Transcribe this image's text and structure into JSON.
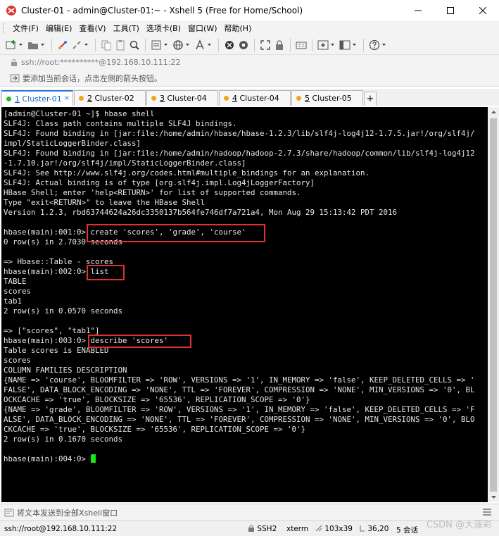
{
  "window": {
    "title": "Cluster-01 - admin@Cluster-01:~ - Xshell 5 (Free for Home/School)"
  },
  "menu": [
    "文件(F)",
    "编辑(E)",
    "查看(V)",
    "工具(T)",
    "选项卡(B)",
    "窗口(W)",
    "帮助(H)"
  ],
  "address": {
    "text": "ssh://root:**********@192.168.10.111:22"
  },
  "info": {
    "text": "要添加当前会话，点击左侧的箭头按钮。"
  },
  "tabs": [
    {
      "num": "1",
      "label": "Cluster-01",
      "color": "#2fb52f",
      "active": true,
      "close": "×"
    },
    {
      "num": "2",
      "label": "Cluster-02",
      "color": "#f2a51a"
    },
    {
      "num": "3",
      "label": "Cluster-04",
      "color": "#f2a51a"
    },
    {
      "num": "4",
      "label": "Cluster-04",
      "color": "#f2a51a"
    },
    {
      "num": "5",
      "label": "Cluster-05",
      "color": "#f2a51a"
    }
  ],
  "tab_add": "+",
  "terminal": {
    "lines": [
      "[admin@Cluster-01 ~]$ hbase shell",
      "SLF4J: Class path contains multiple SLF4J bindings.",
      "SLF4J: Found binding in [jar:file:/home/admin/hbase/hbase-1.2.3/lib/slf4j-log4j12-1.7.5.jar!/org/slf4j/",
      "impl/StaticLoggerBinder.class]",
      "SLF4J: Found binding in [jar:file:/home/admin/hadoop/hadoop-2.7.3/share/hadoop/common/lib/slf4j-log4j12",
      "-1.7.10.jar!/org/slf4j/impl/StaticLoggerBinder.class]",
      "SLF4J: See http://www.slf4j.org/codes.html#multiple_bindings for an explanation.",
      "SLF4J: Actual binding is of type [org.slf4j.impl.Log4jLoggerFactory]",
      "HBase Shell; enter 'help<RETURN>' for list of supported commands.",
      "Type \"exit<RETURN>\" to leave the HBase Shell",
      "Version 1.2.3, rbd63744624a26dc3350137b564fe746df7a721a4, Mon Aug 29 15:13:42 PDT 2016",
      "",
      "hbase(main):001:0> create 'scores', 'grade', 'course'",
      "0 row(s) in 2.7030 seconds",
      "",
      "=> Hbase::Table - scores",
      "hbase(main):002:0> list",
      "TABLE",
      "scores",
      "tab1",
      "2 row(s) in 0.0570 seconds",
      "",
      "=> [\"scores\", \"tab1\"]",
      "hbase(main):003:0> describe 'scores'",
      "Table scores is ENABLED",
      "scores",
      "COLUMN FAMILIES DESCRIPTION",
      "{NAME => 'course', BLOOMFILTER => 'ROW', VERSIONS => '1', IN_MEMORY => 'false', KEEP_DELETED_CELLS => '",
      "FALSE', DATA_BLOCK_ENCODING => 'NONE', TTL => 'FOREVER', COMPRESSION => 'NONE', MIN_VERSIONS => '0', BL",
      "OCKCACHE => 'true', BLOCKSIZE => '65536', REPLICATION_SCOPE => '0'}",
      "{NAME => 'grade', BLOOMFILTER => 'ROW', VERSIONS => '1', IN_MEMORY => 'false', KEEP_DELETED_CELLS => 'F",
      "ALSE', DATA_BLOCK_ENCODING => 'NONE', TTL => 'FOREVER', COMPRESSION => 'NONE', MIN_VERSIONS => '0', BLO",
      "CKCACHE => 'true', BLOCKSIZE => '65536', REPLICATION_SCOPE => '0'}",
      "2 row(s) in 0.1670 seconds",
      "",
      "hbase(main):004:0> "
    ]
  },
  "sendbar": {
    "text": "将文本发送到全部Xshell窗口"
  },
  "status": {
    "connection": "ssh://root@192.168.10.111:22",
    "protocol": "SSH2",
    "terminal_type": "xterm",
    "size": "103x39",
    "cursor_pos": "36,20",
    "sessions": "5 会话"
  },
  "watermark": "CSDN @大菠彩"
}
